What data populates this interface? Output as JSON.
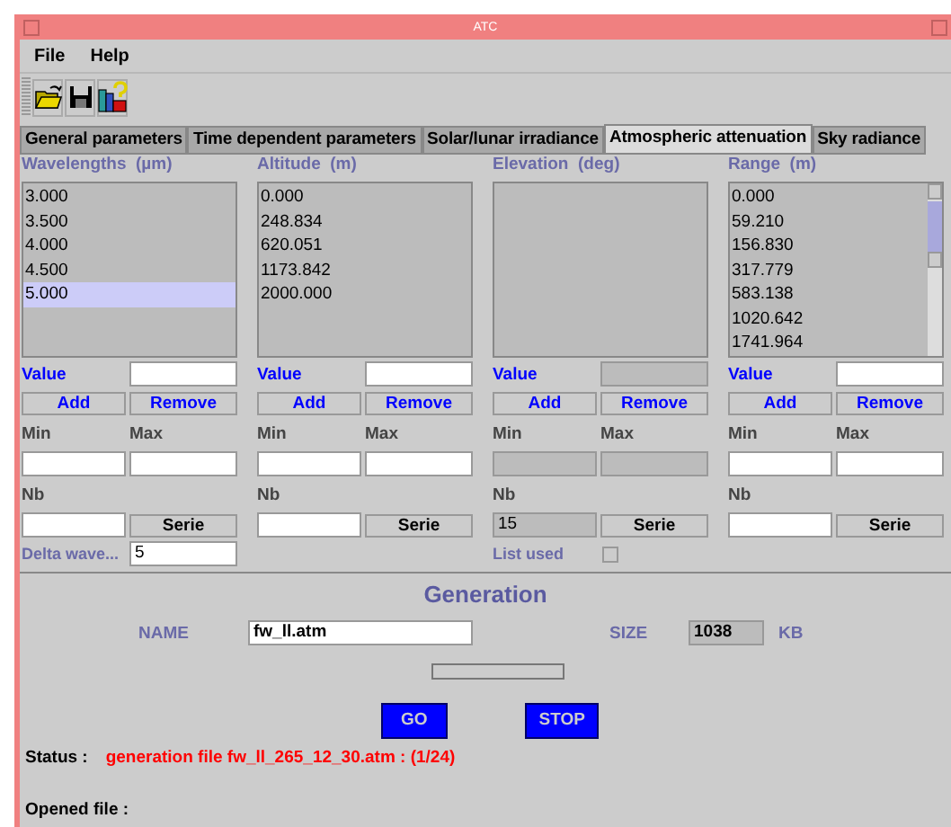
{
  "window": {
    "title": "ATC"
  },
  "menus": [
    {
      "label": "File"
    },
    {
      "label": "Help"
    }
  ],
  "tabs": [
    {
      "label": "General parameters",
      "selected": false
    },
    {
      "label": "Time dependent parameters",
      "selected": false
    },
    {
      "label": "Solar/lunar irradiance",
      "selected": false
    },
    {
      "label": "Atmospheric attenuation",
      "selected": true
    },
    {
      "label": "Sky radiance",
      "selected": false
    }
  ],
  "columns": [
    {
      "header": "Wavelengths  (µm)",
      "items": [
        {
          "text": "3.000",
          "selected": false
        },
        {
          "text": "3.500",
          "selected": false
        },
        {
          "text": "4.000",
          "selected": false
        },
        {
          "text": "4.500",
          "selected": false
        },
        {
          "text": "5.000",
          "selected": true
        }
      ],
      "value_label": "Value",
      "value": {
        "disabled": false
      },
      "add": "Add",
      "remove": "Remove",
      "min_label": "Min",
      "max_label": "Max",
      "min": {
        "disabled": false
      },
      "max": {
        "disabled": false
      },
      "nb_label": "Nb",
      "nb": {
        "disabled": false
      },
      "serie": "Serie",
      "extra": {
        "kind": "field",
        "label": "Delta wave...",
        "value": "5"
      }
    },
    {
      "header": "Altitude  (m)",
      "items": [
        {
          "text": "0.000",
          "selected": false
        },
        {
          "text": "248.834",
          "selected": false
        },
        {
          "text": "620.051",
          "selected": false
        },
        {
          "text": "1173.842",
          "selected": false
        },
        {
          "text": "2000.000",
          "selected": false
        }
      ],
      "value_label": "Value",
      "value": {
        "disabled": false
      },
      "add": "Add",
      "remove": "Remove",
      "min_label": "Min",
      "max_label": "Max",
      "min": {
        "disabled": false
      },
      "max": {
        "disabled": false
      },
      "nb_label": "Nb",
      "nb": {
        "disabled": false
      },
      "serie": "Serie"
    },
    {
      "header": "Elevation  (deg)",
      "value_label": "Value",
      "value": {
        "disabled": true
      },
      "add": "Add",
      "remove": "Remove",
      "min_label": "Min",
      "max_label": "Max",
      "min": {
        "disabled": true
      },
      "max": {
        "disabled": true
      },
      "nb_label": "Nb",
      "nb": {
        "value": "15",
        "disabled": true
      },
      "serie": "Serie",
      "extra": {
        "kind": "checkbox",
        "label": "List used",
        "checked": false
      }
    },
    {
      "header": "Range  (m)",
      "scrollbar": true,
      "items": [
        {
          "text": "0.000",
          "selected": false
        },
        {
          "text": "59.210",
          "selected": false
        },
        {
          "text": "156.830",
          "selected": false
        },
        {
          "text": "317.779",
          "selected": false
        },
        {
          "text": "583.138",
          "selected": false
        },
        {
          "text": "1020.642",
          "selected": false
        },
        {
          "text": "1741.964",
          "selected": false
        }
      ],
      "value_label": "Value",
      "value": {
        "disabled": false
      },
      "add": "Add",
      "remove": "Remove",
      "min_label": "Min",
      "max_label": "Max",
      "min": {
        "disabled": false
      },
      "max": {
        "disabled": false
      },
      "nb_label": "Nb",
      "nb": {
        "disabled": false
      },
      "serie": "Serie"
    }
  ],
  "generation": {
    "title": "Generation",
    "name_label": "NAME",
    "name": "fw_ll.atm",
    "size_label": "SIZE",
    "size": "1038",
    "size_unit": "KB",
    "progress": {
      "level": 0
    },
    "buttons": [
      {
        "label": "GO"
      },
      {
        "label": "STOP"
      }
    ],
    "status_label": "Status :",
    "status": "generation file fw_ll_265_12_30.atm : (1/24)",
    "opened_label": "Opened file :"
  }
}
